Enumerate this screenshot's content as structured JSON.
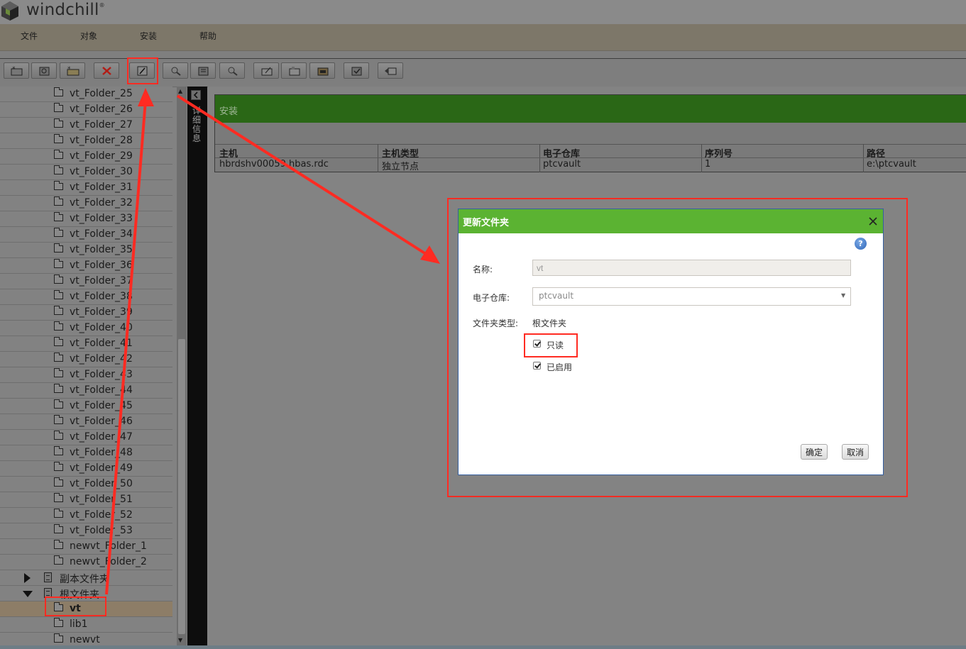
{
  "app": {
    "logo_text": "windchill",
    "logo_mark": "®"
  },
  "menu": [
    "文件",
    "对象",
    "安装",
    "帮助"
  ],
  "toolbar": {
    "buttons": [
      "new-folder-icon",
      "new-vault-icon",
      "new-subfolder-icon",
      "delete-icon",
      "edit-icon",
      "compare-icon",
      "mount-icon",
      "search-icon",
      "update-icon",
      "set-icon",
      "import-icon",
      "validate-icon",
      "rename-icon"
    ]
  },
  "tree": {
    "folders": [
      "vt_Folder_25",
      "vt_Folder_26",
      "vt_Folder_27",
      "vt_Folder_28",
      "vt_Folder_29",
      "vt_Folder_30",
      "vt_Folder_31",
      "vt_Folder_32",
      "vt_Folder_33",
      "vt_Folder_34",
      "vt_Folder_35",
      "vt_Folder_36",
      "vt_Folder_37",
      "vt_Folder_38",
      "vt_Folder_39",
      "vt_Folder_40",
      "vt_Folder_41",
      "vt_Folder_42",
      "vt_Folder_43",
      "vt_Folder_44",
      "vt_Folder_45",
      "vt_Folder_46",
      "vt_Folder_47",
      "vt_Folder_48",
      "vt_Folder_49",
      "vt_Folder_50",
      "vt_Folder_51",
      "vt_Folder_52",
      "vt_Folder_53",
      "newvt_Folder_1",
      "newvt_Folder_2"
    ],
    "replica_label": "副本文件夹",
    "root_label": "根文件夹",
    "root_children": [
      "vt",
      "lib1",
      "newvt"
    ],
    "selected": "vt"
  },
  "side_strip": {
    "label": "详细信息"
  },
  "install_panel": {
    "title": "安装",
    "columns": [
      "主机",
      "主机类型",
      "电子仓库",
      "序列号",
      "路径"
    ],
    "rows": [
      [
        "hbrdshv00059.hbas.rdc",
        "独立节点",
        "ptcvault",
        "1",
        "e:\\ptcvault"
      ]
    ]
  },
  "dialog": {
    "title": "更新文件夹",
    "help": "?",
    "name_label": "名称:",
    "name_value": "vt",
    "vault_label": "电子仓库:",
    "vault_value": "ptcvault",
    "type_label": "文件夹类型:",
    "type_value": "根文件夹",
    "readonly_label": "只读",
    "readonly_checked": true,
    "enabled_label": "已启用",
    "enabled_checked": true,
    "ok_label": "确定",
    "cancel_label": "取消"
  },
  "colors": {
    "annotation": "#ff2b22",
    "dialog_header": "#5bb332",
    "panel_header": "#2a6716"
  }
}
